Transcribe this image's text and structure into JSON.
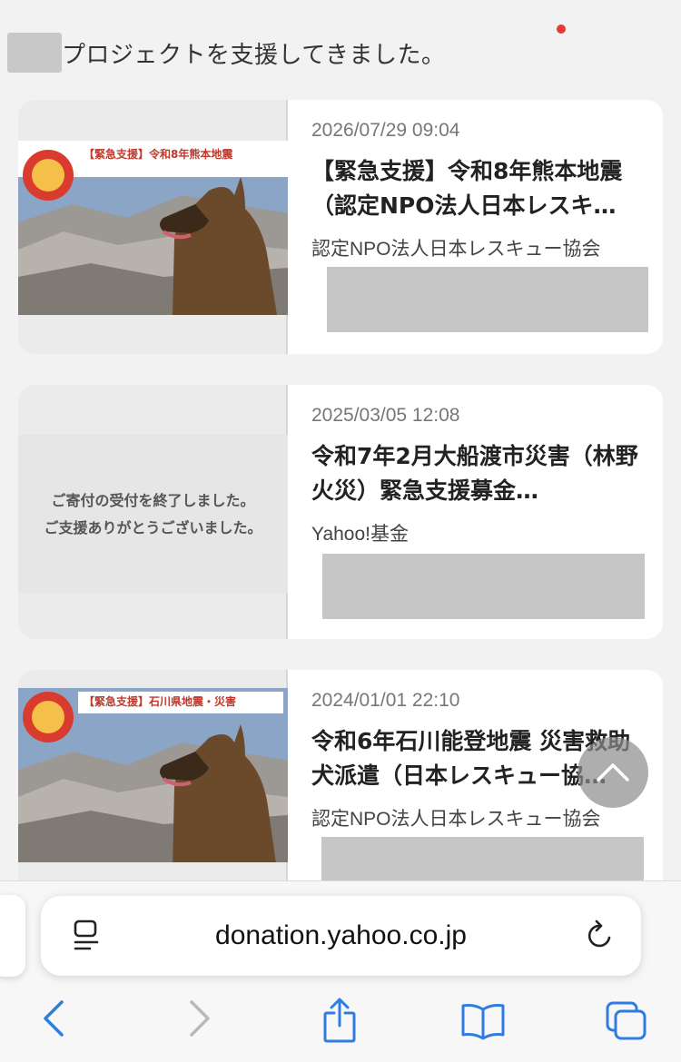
{
  "header": {
    "text": "プロジェクトを支援してきました。"
  },
  "cards": [
    {
      "date": "2026/07/29 09:04",
      "title": "【緊急支援】令和8年熊本地震（認定NPO法人日本レスキ…",
      "org": "認定NPO法人日本レスキュー協会",
      "banner": "【緊急支援】令和8年熊本地震"
    },
    {
      "date": "2025/03/05 12:08",
      "title": "令和7年2月大船渡市災害（林野火災）緊急支援募金…",
      "org": "Yahoo!基金",
      "ended_line1": "ご寄付の受付を終了しました。",
      "ended_line2": "ご支援ありがとうございました。"
    },
    {
      "date": "2024/01/01 22:10",
      "title": "令和6年石川能登地震 災害救助犬派遣（日本レスキュー協…",
      "org": "認定NPO法人日本レスキュー協会",
      "banner": "【緊急支援】石川県地震・災害"
    }
  ],
  "browser": {
    "url": "donation.yahoo.co.jp",
    "accent": "#2f7de1"
  },
  "icons": {
    "reader": "reader-icon",
    "reload": "reload-icon",
    "back": "back-icon",
    "forward": "forward-icon",
    "share": "share-icon",
    "bookmarks": "book-icon",
    "tabs": "tabs-icon",
    "scroll_top": "chevron-up-icon"
  }
}
